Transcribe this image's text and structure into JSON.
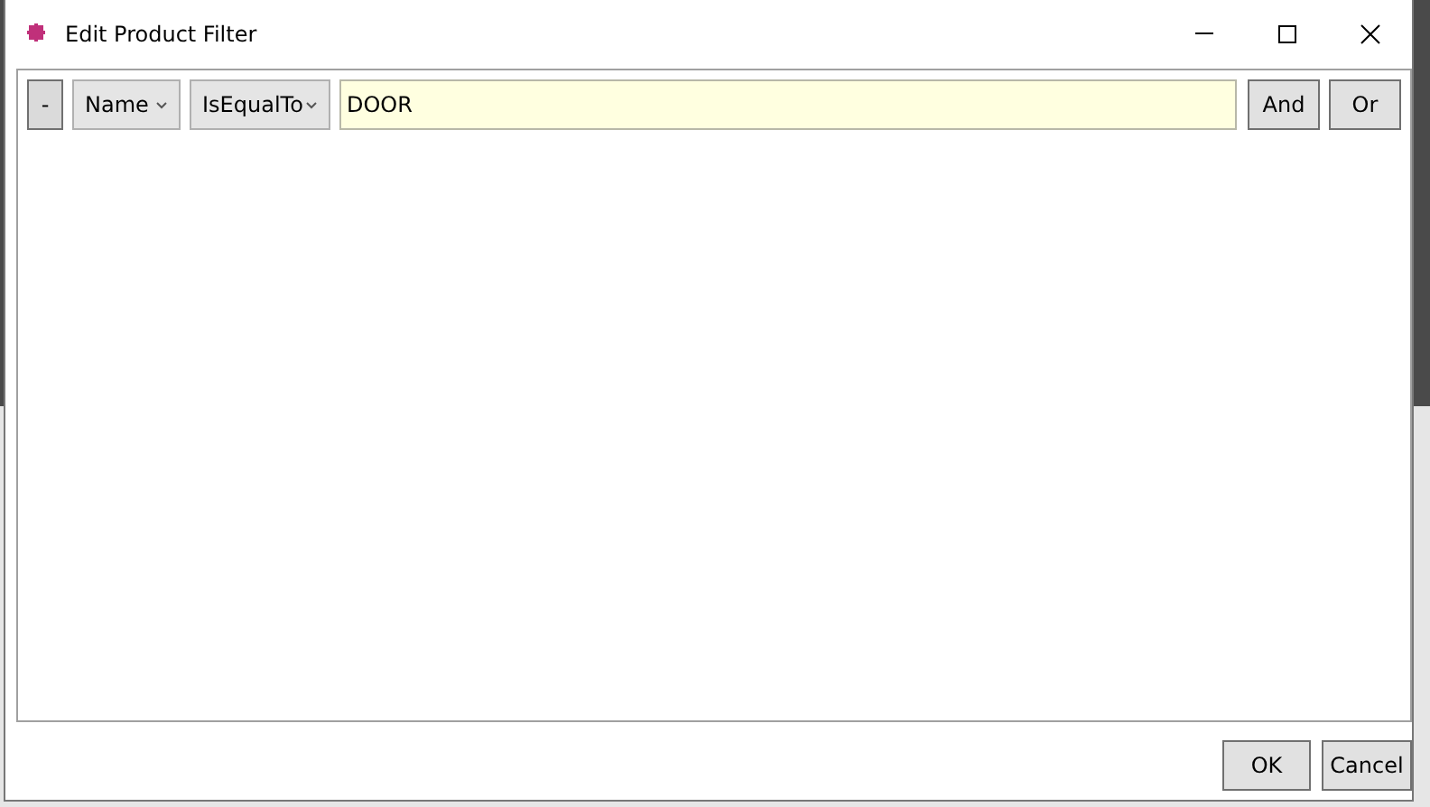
{
  "window": {
    "title": "Edit Product Filter"
  },
  "filter_rows": [
    {
      "remove": "-",
      "field": "Name",
      "operator": "IsEqualTo",
      "value": "DOOR",
      "and": "And",
      "or": "Or"
    }
  ],
  "buttons": [
    "OK",
    "Cancel"
  ]
}
